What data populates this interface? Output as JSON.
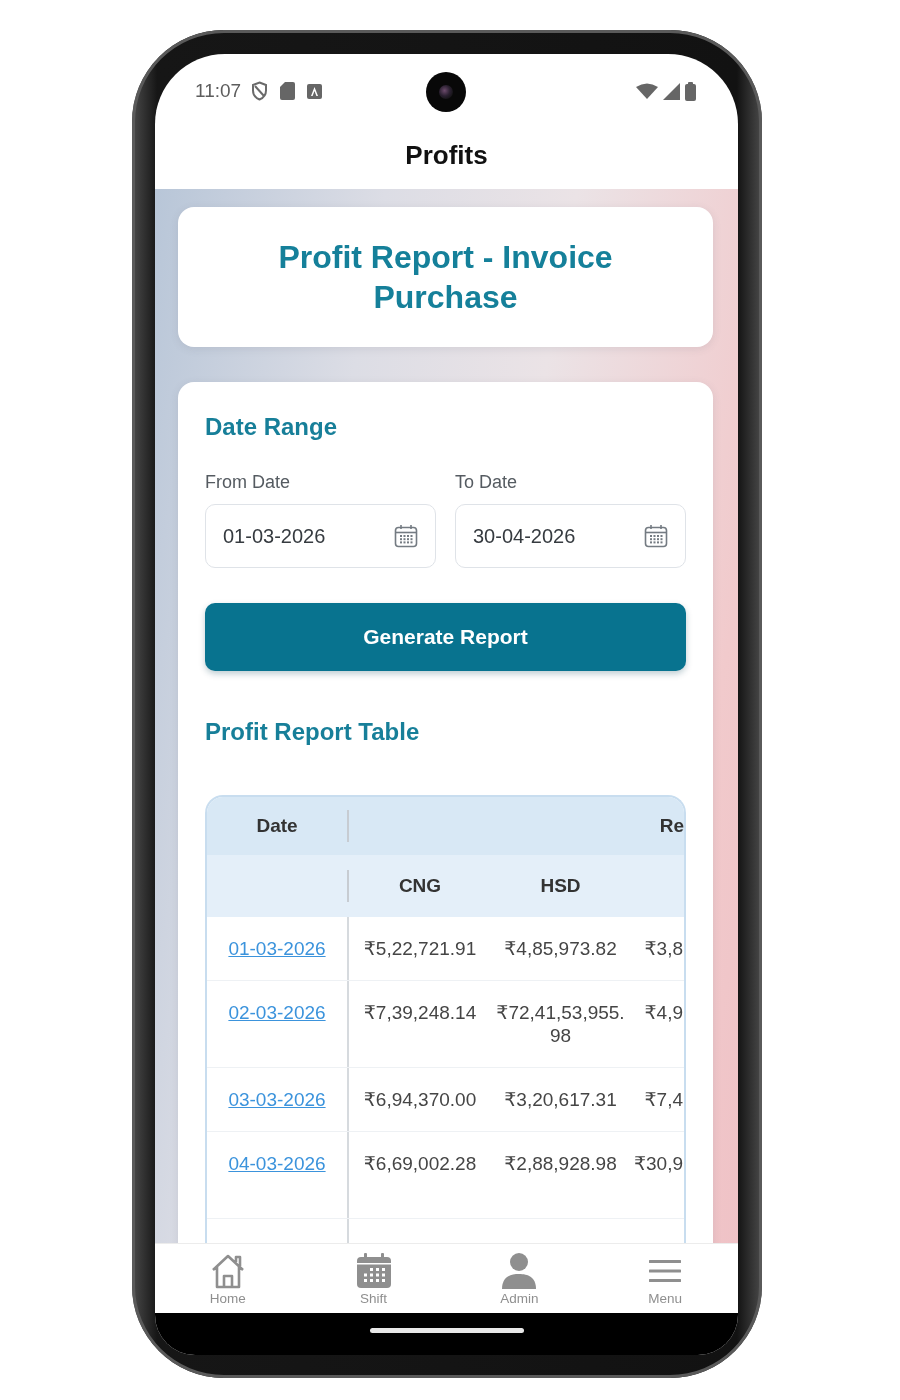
{
  "status_bar": {
    "time": "11:07"
  },
  "app_bar": {
    "title": "Profits"
  },
  "report_card": {
    "title": "Profit Report - Invoice Purchase"
  },
  "date_range": {
    "heading": "Date Range",
    "fields": [
      {
        "label": "From Date",
        "value": "01-03-2026"
      },
      {
        "label": "To Date",
        "value": "30-04-2026"
      }
    ],
    "button": "Generate Report"
  },
  "report_table": {
    "heading": "Profit Report Table",
    "group_headers": [
      "Date",
      "Re"
    ],
    "sub_headers": [
      "CNG",
      "HSD"
    ],
    "rows": [
      {
        "date": "01-03-2026",
        "values": [
          "₹5,22,721.91",
          "₹4,85,973.82",
          "₹3,8"
        ]
      },
      {
        "date": "02-03-2026",
        "values": [
          "₹7,39,248.14",
          "₹72,41,53,955.98",
          "₹4,9"
        ]
      },
      {
        "date": "03-03-2026",
        "values": [
          "₹6,94,370.00",
          "₹3,20,617.31",
          "₹7,4"
        ]
      },
      {
        "date": "04-03-2026",
        "values": [
          "₹6,69,002.28",
          "₹2,88,928.98",
          "₹30,9"
        ]
      }
    ]
  },
  "bottom_nav": [
    {
      "label": "Home"
    },
    {
      "label": "Shift"
    },
    {
      "label": "Admin"
    },
    {
      "label": "Menu"
    }
  ]
}
